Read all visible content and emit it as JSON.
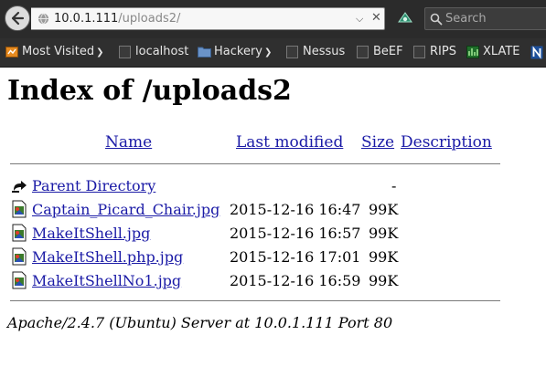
{
  "browser": {
    "url_host": "10.0.1.111",
    "url_path": "/uploads2/",
    "search_placeholder": "Search"
  },
  "bookmarks": [
    {
      "label": "Most Visited",
      "icon": "most-visited-icon",
      "has_menu": true
    },
    {
      "label": "localhost",
      "icon": "page-icon",
      "has_menu": false
    },
    {
      "label": "Hackery",
      "icon": "folder-icon",
      "has_menu": true
    },
    {
      "label": "Nessus",
      "icon": "page-icon",
      "has_menu": false
    },
    {
      "label": "BeEF",
      "icon": "page-icon",
      "has_menu": false
    },
    {
      "label": "RIPS",
      "icon": "page-icon",
      "has_menu": false
    },
    {
      "label": "XLATE",
      "icon": "xlate-icon",
      "has_menu": false
    }
  ],
  "page": {
    "heading": "Index of /uploads2",
    "columns": {
      "name": "Name",
      "last_modified": "Last modified",
      "size": "Size",
      "description": "Description"
    },
    "parent": {
      "name": "Parent Directory",
      "size": "-"
    },
    "files": [
      {
        "name": "Captain_Picard_Chair.jpg",
        "modified": "2015-12-16 16:47",
        "size": "99K"
      },
      {
        "name": "MakeItShell.jpg",
        "modified": "2015-12-16 16:57",
        "size": "99K"
      },
      {
        "name": "MakeItShell.php.jpg",
        "modified": "2015-12-16 17:01",
        "size": "99K"
      },
      {
        "name": "MakeItShellNo1.jpg",
        "modified": "2015-12-16 16:59",
        "size": "99K"
      }
    ],
    "footer": "Apache/2.4.7 (Ubuntu) Server at 10.0.1.111 Port 80"
  }
}
